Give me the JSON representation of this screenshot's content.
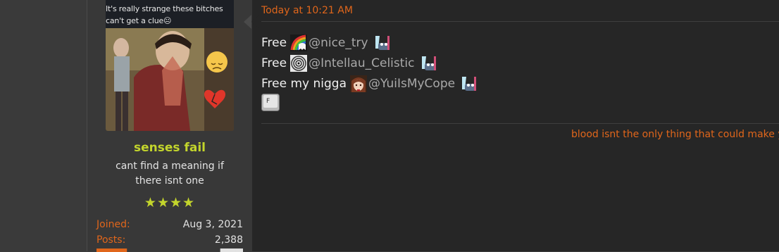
{
  "user": {
    "avatar_caption": "It's really strange these bitches can't get a clue😐",
    "username": "senses fail",
    "title": "cant find a meaning if there isnt one",
    "stars": "★★★★",
    "stats": [
      {
        "label": "Joined:",
        "value": "Aug 3, 2021"
      },
      {
        "label": "Posts:",
        "value": "2,388"
      }
    ]
  },
  "post": {
    "timestamp": "Today at 10:21 AM",
    "lines": [
      {
        "prefix": "Free",
        "emoji": "rainbow-ghost-icon",
        "mention": "@nice_try",
        "trail_emoji": "pepe-freeze-icon"
      },
      {
        "prefix": "Free",
        "emoji": "spiral-eye-icon",
        "mention": "@Intellau_Celistic",
        "trail_emoji": "pepe-freeze-icon"
      },
      {
        "prefix": "Free my nigga",
        "emoji": "anime-girl-icon",
        "mention": "@YuiIsMyCope",
        "trail_emoji": "pepe-freeze-icon"
      }
    ],
    "key_emoji": "F",
    "signature": "blood isnt the only thing that could make y"
  },
  "colors": {
    "accent_orange": "#e0661b",
    "username_green": "#c3d52c"
  }
}
